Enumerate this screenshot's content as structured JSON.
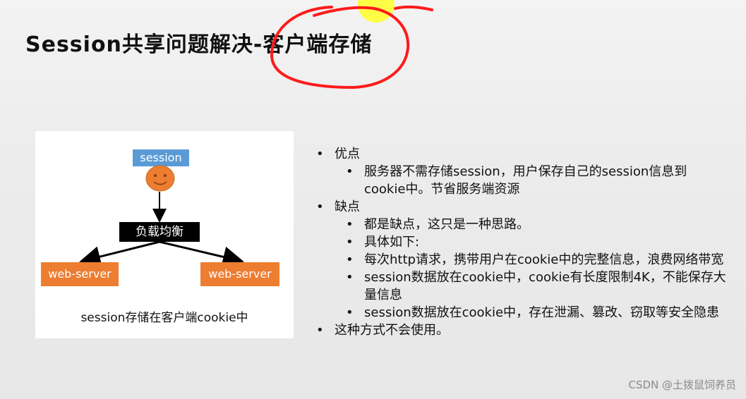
{
  "slide": {
    "title": "Session共享问题解决-客户端存储"
  },
  "diagram": {
    "session_label": "session",
    "load_balancer_label": "负载均衡",
    "server_left_label": "web-server",
    "server_right_label": "web-server",
    "caption": "session存储在客户端cookie中",
    "colors": {
      "session": "#5b9bd5",
      "face": "#ed7d31",
      "load_balancer": "#000000",
      "server": "#ed7d31"
    }
  },
  "bullets": {
    "pros_heading": "优点",
    "pros_items": [
      "服务器不需存储session，用户保存自己的session信息到cookie中。节省服务端资源"
    ],
    "cons_heading": "缺点",
    "cons_items": [
      "都是缺点，这只是一种思路。",
      "具体如下:",
      "每次http请求，携带用户在cookie中的完整信息，浪费网络带宽",
      "session数据放在cookie中，cookie有长度限制4K，不能保存大量信息",
      "session数据放在cookie中，存在泄漏、篡改、窃取等安全隐患"
    ],
    "conclusion": "这种方式不会使用。"
  },
  "watermark": "CSDN @土拨鼠饲养员",
  "annotation_color": "#ff1a1a",
  "pointer_color": "#ffff00"
}
